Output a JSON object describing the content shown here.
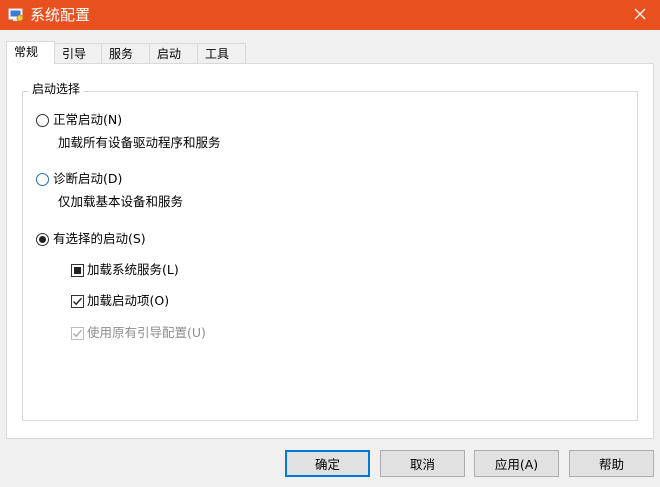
{
  "window": {
    "title": "系统配置",
    "close_symbol": "✕"
  },
  "tabs": [
    {
      "label": "常规",
      "active": true
    },
    {
      "label": "引导",
      "active": false
    },
    {
      "label": "服务",
      "active": false
    },
    {
      "label": "启动",
      "active": false
    },
    {
      "label": "工具",
      "active": false
    }
  ],
  "startup_group": {
    "legend": "启动选择",
    "normal": {
      "label": "正常启动(N)",
      "description": "加载所有设备驱动程序和服务",
      "selected": false
    },
    "diagnostic": {
      "label": "诊断启动(D)",
      "description": "仅加载基本设备和服务",
      "selected": false
    },
    "selective": {
      "label": "有选择的启动(S)",
      "selected": true,
      "options": {
        "load_system_services": {
          "label": "加载系统服务(L)",
          "state": "indeterminate"
        },
        "load_startup_items": {
          "label": "加载启动项(O)",
          "state": "checked"
        },
        "use_original_boot_config": {
          "label": "使用原有引导配置(U)",
          "state": "checked-disabled"
        }
      }
    }
  },
  "buttons": {
    "ok": "确定",
    "cancel": "取消",
    "apply": "应用(A)",
    "help": "帮助"
  },
  "colors": {
    "titlebar": "#e8501f",
    "default_button_border": "#0078d7"
  }
}
